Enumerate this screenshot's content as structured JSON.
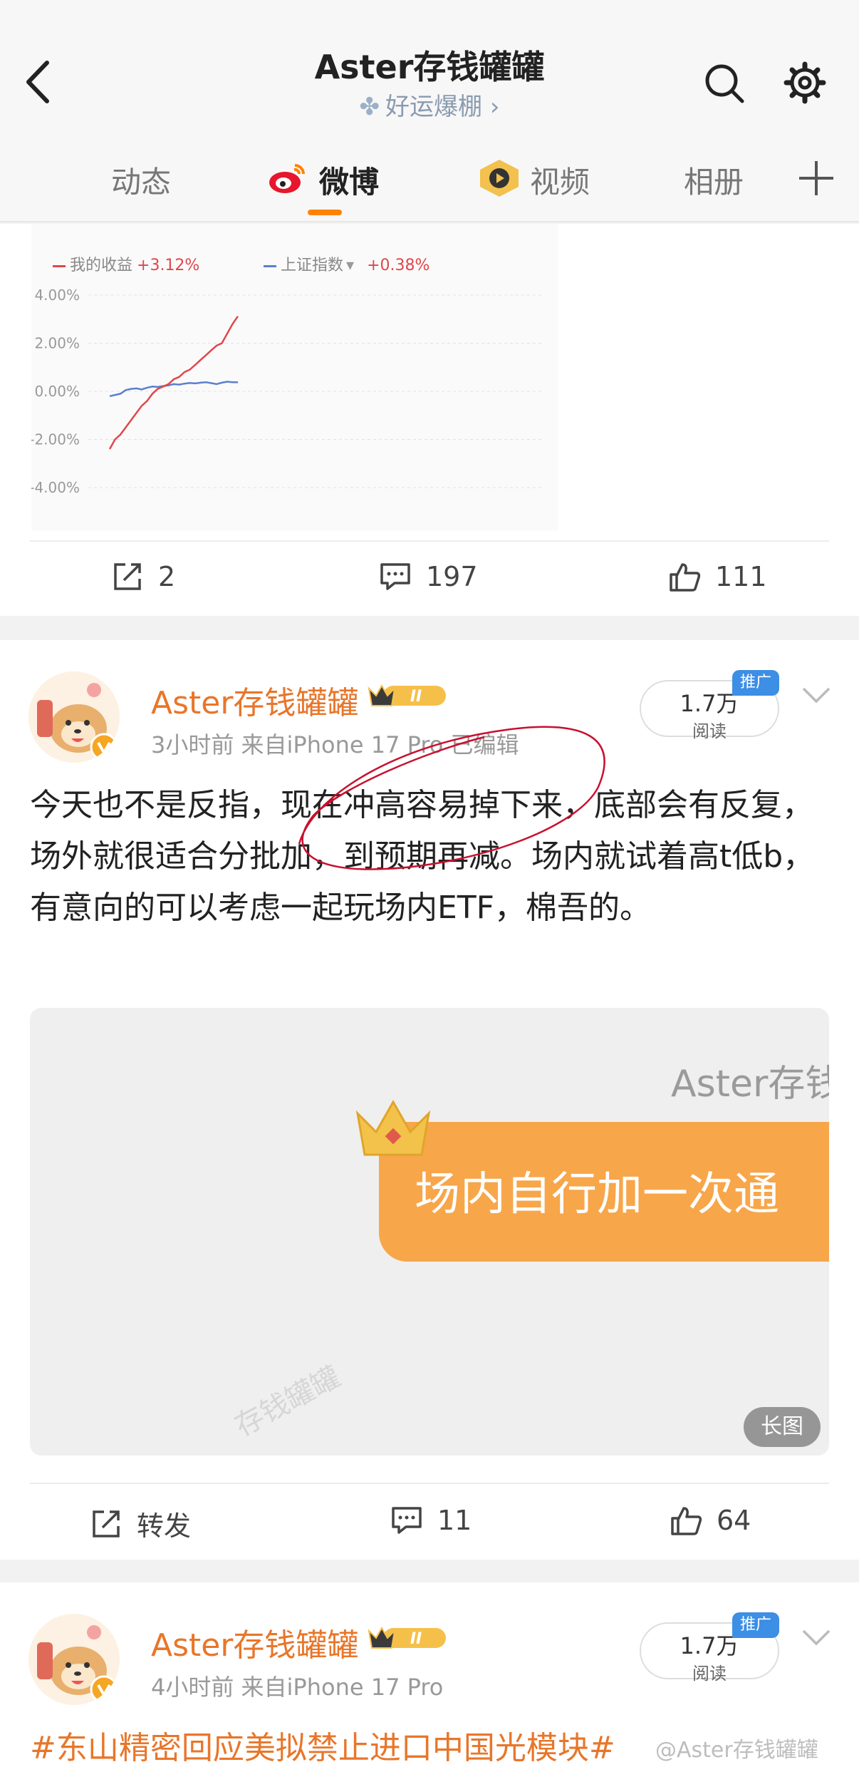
{
  "header": {
    "title": "Aster存钱罐罐",
    "subtitle": "好运爆棚",
    "subtitle_arrow": "›"
  },
  "tabs": [
    {
      "label": "动态"
    },
    {
      "label": "微博"
    },
    {
      "label": "视频"
    },
    {
      "label": "相册"
    }
  ],
  "chart_data": {
    "type": "line",
    "series": [
      {
        "name": "我的收益",
        "change": "+3.12%",
        "color": "#e0474c"
      },
      {
        "name": "上证指数",
        "change": "+0.38%",
        "color": "#5b7fd0"
      }
    ],
    "legend_arrow": "▾",
    "yticks": [
      "4.00%",
      "2.00%",
      "0.00%",
      "-2.00%",
      "-4.00%"
    ],
    "ylim": [
      -4,
      4
    ],
    "red_points": [
      -2.4,
      -2.0,
      -1.8,
      -1.5,
      -1.2,
      -0.9,
      -0.6,
      -0.4,
      -0.1,
      0.1,
      0.2,
      0.3,
      0.5,
      0.6,
      0.8,
      0.9,
      1.1,
      1.3,
      1.5,
      1.7,
      1.9,
      2.0,
      2.4,
      2.8,
      3.12
    ],
    "blue_points": [
      -0.2,
      -0.15,
      -0.1,
      0.05,
      0.1,
      0.12,
      0.08,
      0.15,
      0.2,
      0.18,
      0.22,
      0.25,
      0.3,
      0.28,
      0.32,
      0.35,
      0.33,
      0.36,
      0.38,
      0.34,
      0.3,
      0.36,
      0.4,
      0.38,
      0.38
    ]
  },
  "card1_actions": {
    "share": "2",
    "comment": "197",
    "like": "111"
  },
  "post1": {
    "name": "Aster存钱罐罐",
    "meta": "3小时前  来自iPhone 17 Pro  已编辑",
    "reads_num": "1.7万",
    "reads_label": "阅读",
    "promo": "推广",
    "text": "今天也不是反指，现在冲高容易掉下来，底部会有反复，场外就很适合分批加，到预期再减。场内就试着高t低b，有意向的可以考虑一起玩场内ETF，棉吾的。",
    "image_brand": "Aster存钱",
    "image_text": "场内自行加一次通",
    "image_watermark": "存钱罐罐",
    "image_long": "长图",
    "actions": {
      "share": "转发",
      "comment": "11",
      "like": "64"
    }
  },
  "post2": {
    "name": "Aster存钱罐罐",
    "meta": "4小时前  来自iPhone 17 Pro",
    "reads_num": "1.7万",
    "reads_label": "阅读",
    "promo": "推广",
    "hashtag": "#东山精密回应美拟禁止进口中国光模块#"
  },
  "watermark": "@Aster存钱罐罐",
  "colors": {
    "accent": "#ff8200",
    "name": "#e8762a",
    "promo": "#3d8ee5"
  }
}
